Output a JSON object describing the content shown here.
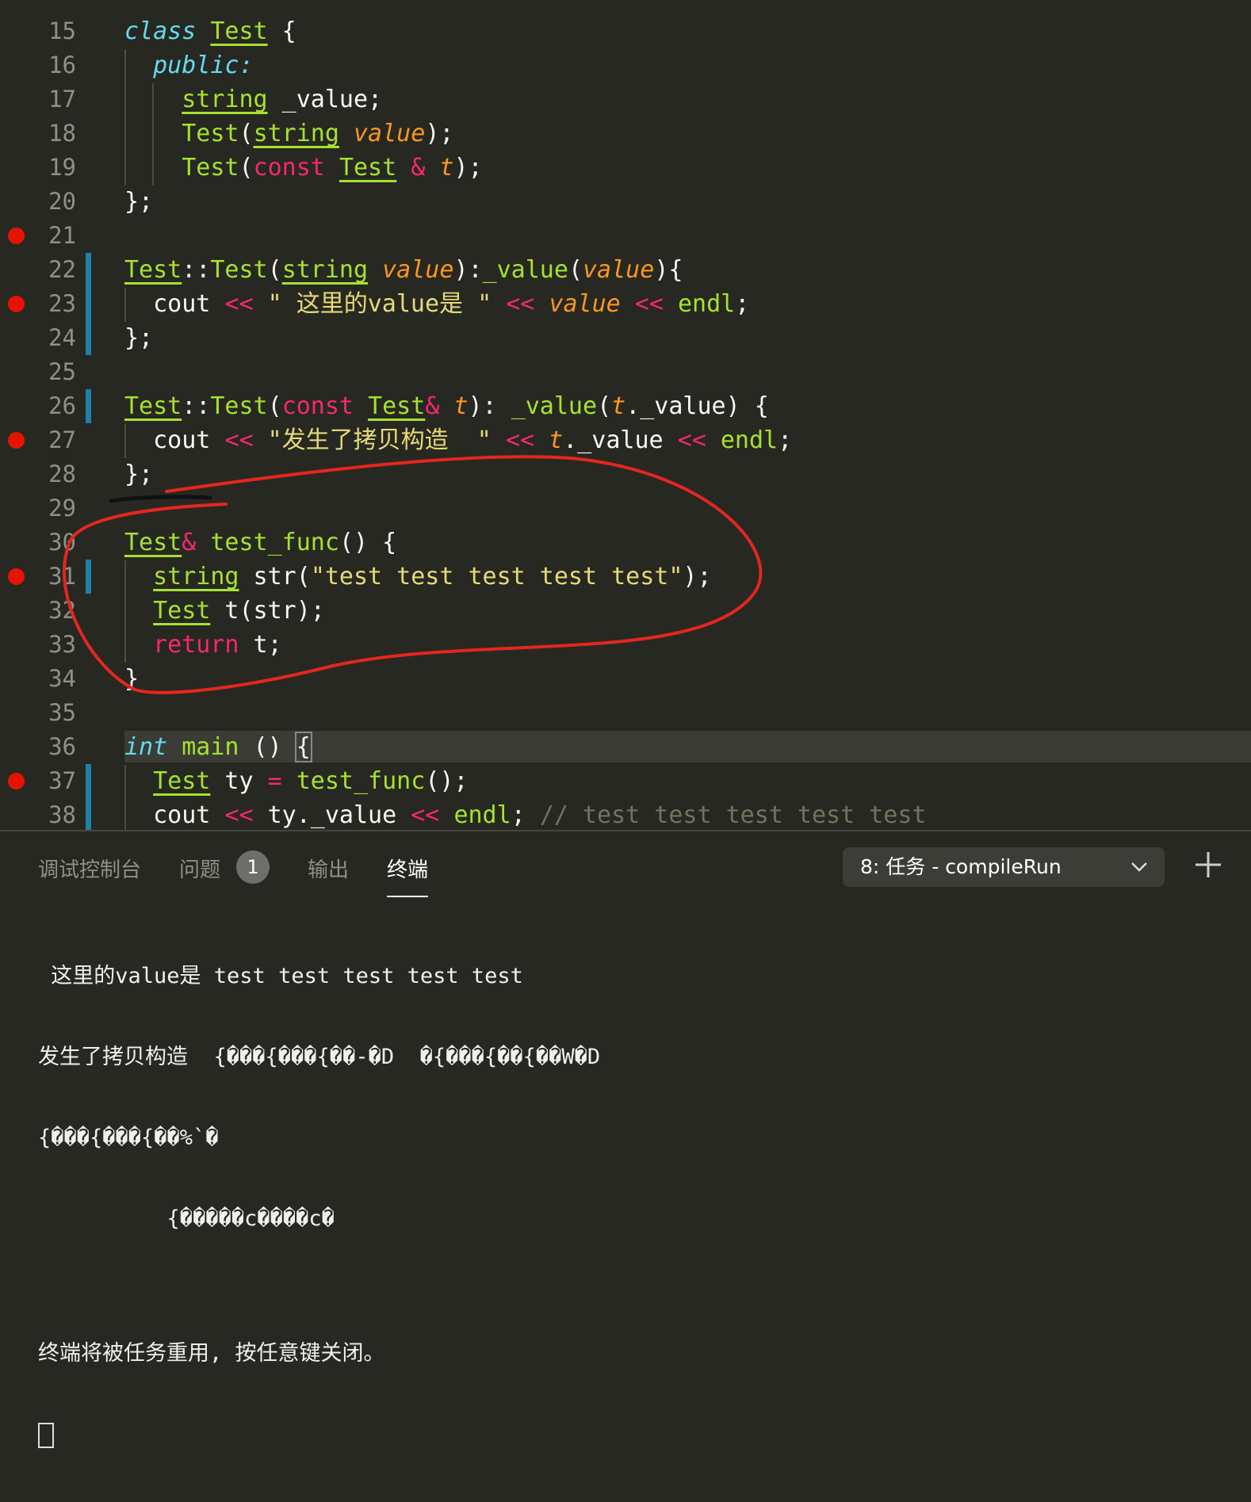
{
  "editor": {
    "lines": [
      {
        "n": "15",
        "html": "<span class='kw-it'>class</span> <span class='cls'>Test</span> {"
      },
      {
        "n": "16",
        "html": "  <span class='kw-it'>public:</span>"
      },
      {
        "n": "17",
        "html": "    <span class='cls'>string</span> _value;"
      },
      {
        "n": "18",
        "html": "    <span class='fn'>Test</span>(<span class='cls'>string</span> <span class='par'>value</span>);"
      },
      {
        "n": "19",
        "html": "    <span class='fn'>Test</span>(<span class='kw'>const</span> <span class='cls'>Test</span> <span class='op'>&amp;</span> <span class='par'>t</span>);"
      },
      {
        "n": "20",
        "html": "};"
      },
      {
        "n": "21",
        "html": ""
      },
      {
        "n": "22",
        "html": "<span class='cls'>Test</span>::<span class='fn'>Test</span>(<span class='cls'>string</span> <span class='par'>value</span>):<span class='fn'>_value</span>(<span class='par'>value</span>){"
      },
      {
        "n": "23",
        "html": "  cout <span class='op'>&lt;&lt;</span> <span class='str'>\" 这里的value是 \"</span> <span class='op'>&lt;&lt;</span> <span class='par'>value</span> <span class='op'>&lt;&lt;</span> <span class='fn'>endl</span>;"
      },
      {
        "n": "24",
        "html": "};"
      },
      {
        "n": "25",
        "html": ""
      },
      {
        "n": "26",
        "html": "<span class='cls'>Test</span>::<span class='fn'>Test</span>(<span class='kw'>const</span> <span class='cls'>Test</span><span class='op'>&amp;</span> <span class='par'>t</span>): <span class='fn'>_value</span>(<span class='par'>t</span>._value) {"
      },
      {
        "n": "27",
        "html": "  cout <span class='op'>&lt;&lt;</span> <span class='str'>\"发生了拷贝构造  \"</span> <span class='op'>&lt;&lt;</span> <span class='par'>t</span>._value <span class='op'>&lt;&lt;</span> <span class='fn'>endl</span>;"
      },
      {
        "n": "28",
        "html": "};"
      },
      {
        "n": "29",
        "html": ""
      },
      {
        "n": "30",
        "html": "<span class='cls'>Test</span><span class='op'>&amp;</span> <span class='fn'>test_func</span>() {"
      },
      {
        "n": "31",
        "html": "  <span class='cls'>string</span> str(<span class='str'>\"test test test test test\"</span>);"
      },
      {
        "n": "32",
        "html": "  <span class='cls'>Test</span> t(str);"
      },
      {
        "n": "33",
        "html": "  <span class='kw'>return</span> t;"
      },
      {
        "n": "34",
        "html": "}"
      },
      {
        "n": "35",
        "html": ""
      },
      {
        "n": "36",
        "html": "<span class='kw-it'>int</span> <span class='fn'>main</span> () <span class='br'>{</span>"
      },
      {
        "n": "37",
        "html": "  <span class='cls'>Test</span> ty <span class='op'>=</span> <span class='fn'>test_func</span>();"
      },
      {
        "n": "38",
        "html": "  cout <span class='op'>&lt;&lt;</span> ty._value <span class='op'>&lt;&lt;</span> <span class='fn'>endl</span>; <span class='cmt'>// test test test test test</span>"
      }
    ],
    "breakpoints": [
      "21",
      "23",
      "27",
      "31",
      "37"
    ],
    "diff_lines": [
      "22",
      "23",
      "24",
      "26",
      "31",
      "37",
      "38"
    ]
  },
  "panel": {
    "tabs": [
      {
        "label": "调试控制台",
        "active": false
      },
      {
        "label": "问题",
        "active": false
      },
      {
        "label": "输出",
        "active": false
      },
      {
        "label": "终端",
        "active": true
      }
    ],
    "problems_badge": "1",
    "task_select": "8: 任务 - compileRun",
    "terminal_lines": [
      " 这里的value是 test test test test test",
      "发生了拷贝构造  {���{���{��-�D  �{���{��{��W�D",
      "{���{���{��%`�",
      "          {�����c����c�",
      "",
      "终端将被任务重用, 按任意键关闭。"
    ]
  },
  "colors": {
    "background": "#272822",
    "breakpoint": "#e51400",
    "annotation": "#e52620"
  }
}
